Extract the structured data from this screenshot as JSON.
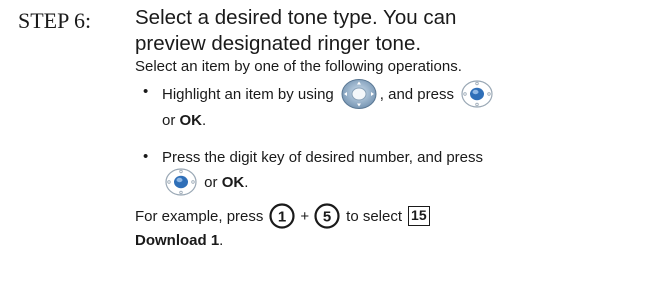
{
  "step": {
    "label": "STEP 6:"
  },
  "heading": {
    "line1": "Select a desired tone type. You can",
    "line2": "preview designated ringer tone."
  },
  "intro": "Select an item by one of the following operations.",
  "bullets": [
    {
      "text_a": "Highlight an item by using",
      "text_b": ", and press",
      "text_c_pre": "or ",
      "text_c_bold": "OK",
      "text_c_post": "."
    },
    {
      "text_a": "Press the digit key of desired number, and press",
      "text_b_pre": " or ",
      "text_b_bold": "OK",
      "text_b_post": "."
    }
  ],
  "bullet_symbol": "•",
  "example": {
    "text_a": "For example, press",
    "key1": "1",
    "plus": "+",
    "key2": "5",
    "text_b": "to select",
    "item_number": "15",
    "item_name": "Download 1",
    "period": "."
  },
  "icons": {
    "nav": "navigation-key-icon",
    "center": "center-select-key-icon",
    "digit": "digit-key-icon"
  }
}
